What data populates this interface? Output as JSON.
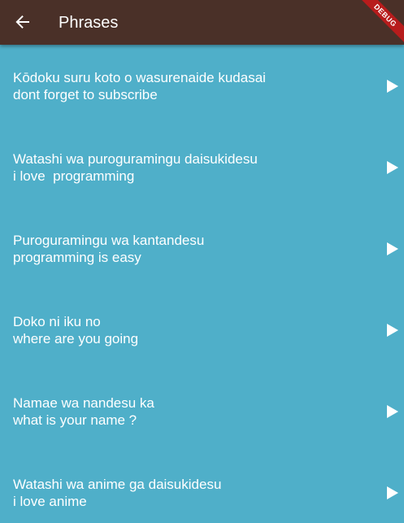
{
  "appbar": {
    "title": "Phrases",
    "back_icon": "arrow-back-icon",
    "debug_label": "DEBUG",
    "color": "#4a3028"
  },
  "colors": {
    "background": "#4fafc9",
    "debug_ribbon": "#b71c1c",
    "text": "#ffffff"
  },
  "phrases": [
    {
      "japanese": "Kōdoku suru koto o wasurenaide kudasai",
      "english": "dont forget to subscribe",
      "icon": "play-icon"
    },
    {
      "japanese": "Watashi wa puroguramingu daisukidesu",
      "english": "i love  programming",
      "icon": "play-icon"
    },
    {
      "japanese": "Puroguramingu wa kantandesu",
      "english": "programming is easy",
      "icon": "play-icon"
    },
    {
      "japanese": "Doko ni iku no",
      "english": "where are you going",
      "icon": "play-icon"
    },
    {
      "japanese": "Namae wa nandesu ka",
      "english": "what is your name ?",
      "icon": "play-icon"
    },
    {
      "japanese": "Watashi wa anime ga daisukidesu",
      "english": "i love anime",
      "icon": "play-icon"
    }
  ]
}
